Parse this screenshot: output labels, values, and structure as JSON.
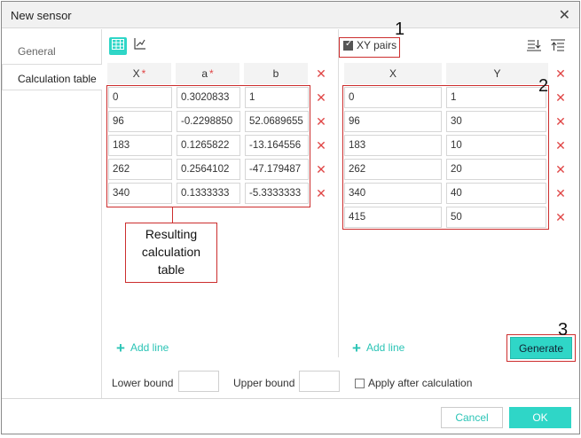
{
  "window": {
    "title": "New sensor"
  },
  "sidebar": {
    "items": [
      {
        "label": "General",
        "active": false
      },
      {
        "label": "Calculation table",
        "active": true
      }
    ]
  },
  "left_table": {
    "headers": [
      {
        "label": "X",
        "required": true
      },
      {
        "label": "a",
        "required": true
      },
      {
        "label": "b",
        "required": false
      }
    ],
    "rows": [
      [
        "0",
        "0.3020833",
        "1"
      ],
      [
        "96",
        "-0.2298850",
        "52.0689655"
      ],
      [
        "183",
        "0.1265822",
        "-13.164556"
      ],
      [
        "262",
        "0.2564102",
        "-47.179487"
      ],
      [
        "340",
        "0.1333333",
        "-5.3333333"
      ]
    ],
    "add_line": "Add line"
  },
  "right_table": {
    "xy_pairs_label": "XY pairs",
    "headers": [
      "X",
      "Y"
    ],
    "rows": [
      [
        "0",
        "1"
      ],
      [
        "96",
        "30"
      ],
      [
        "183",
        "10"
      ],
      [
        "262",
        "20"
      ],
      [
        "340",
        "40"
      ],
      [
        "415",
        "50"
      ]
    ],
    "add_line": "Add line",
    "generate": "Generate"
  },
  "annotations": {
    "marker_1": "1",
    "marker_2": "2",
    "marker_3": "3",
    "callout": [
      "Resulting",
      "calculation",
      "table"
    ]
  },
  "bounds": {
    "lower_label": "Lower bound",
    "upper_label": "Upper bound",
    "apply_label": "Apply after calculation"
  },
  "footer": {
    "cancel": "Cancel",
    "ok": "OK"
  },
  "colors": {
    "accent": "#2fd6c7",
    "annotation": "#cc2e2e",
    "delete": "#e04646"
  },
  "icons": {
    "close": "close-icon",
    "delete": "delete-row-icon",
    "table_view": "table-view-icon",
    "chart_view": "chart-view-icon",
    "import": "import-icon",
    "export": "export-icon",
    "add": "plus-icon"
  }
}
